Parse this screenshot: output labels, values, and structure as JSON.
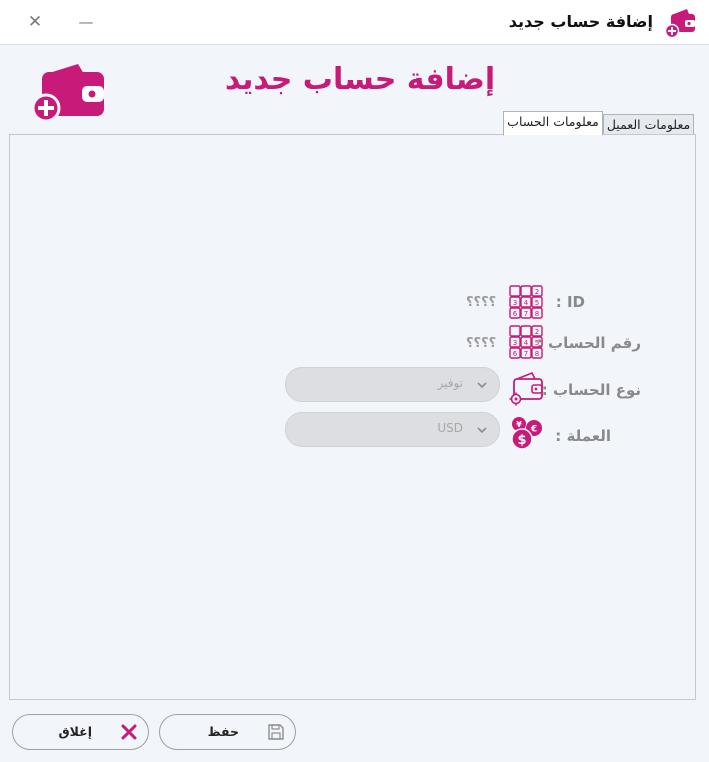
{
  "window": {
    "title": "إضافة حساب جديد",
    "close_glyph": "✕",
    "minimize_glyph": "—"
  },
  "header": {
    "title": "إضافة حساب جديد"
  },
  "tabs": [
    {
      "label": "معلومات العميل",
      "active": false
    },
    {
      "label": "معلومات الحساب",
      "active": true
    }
  ],
  "form": {
    "id": {
      "label": "ID :",
      "value": "؟؟؟؟",
      "icon": "number-grid-icon"
    },
    "account_number": {
      "label": "رقم الحساب :",
      "value": "؟؟؟؟",
      "icon": "number-grid-icon"
    },
    "account_type": {
      "label": "نوع الحساب :",
      "value": "توفير",
      "icon": "wallet-gear-icon"
    },
    "currency": {
      "label": "العملة :",
      "value": "USD",
      "icon": "currency-coins-icon"
    }
  },
  "buttons": {
    "save": {
      "label": "حفظ",
      "icon": "save-icon"
    },
    "close": {
      "label": "إغلاق",
      "icon": "x-icon"
    }
  },
  "colors": {
    "accent": "#c81a78",
    "background": "#f2f5fa",
    "muted_text": "#8a8a8a"
  }
}
